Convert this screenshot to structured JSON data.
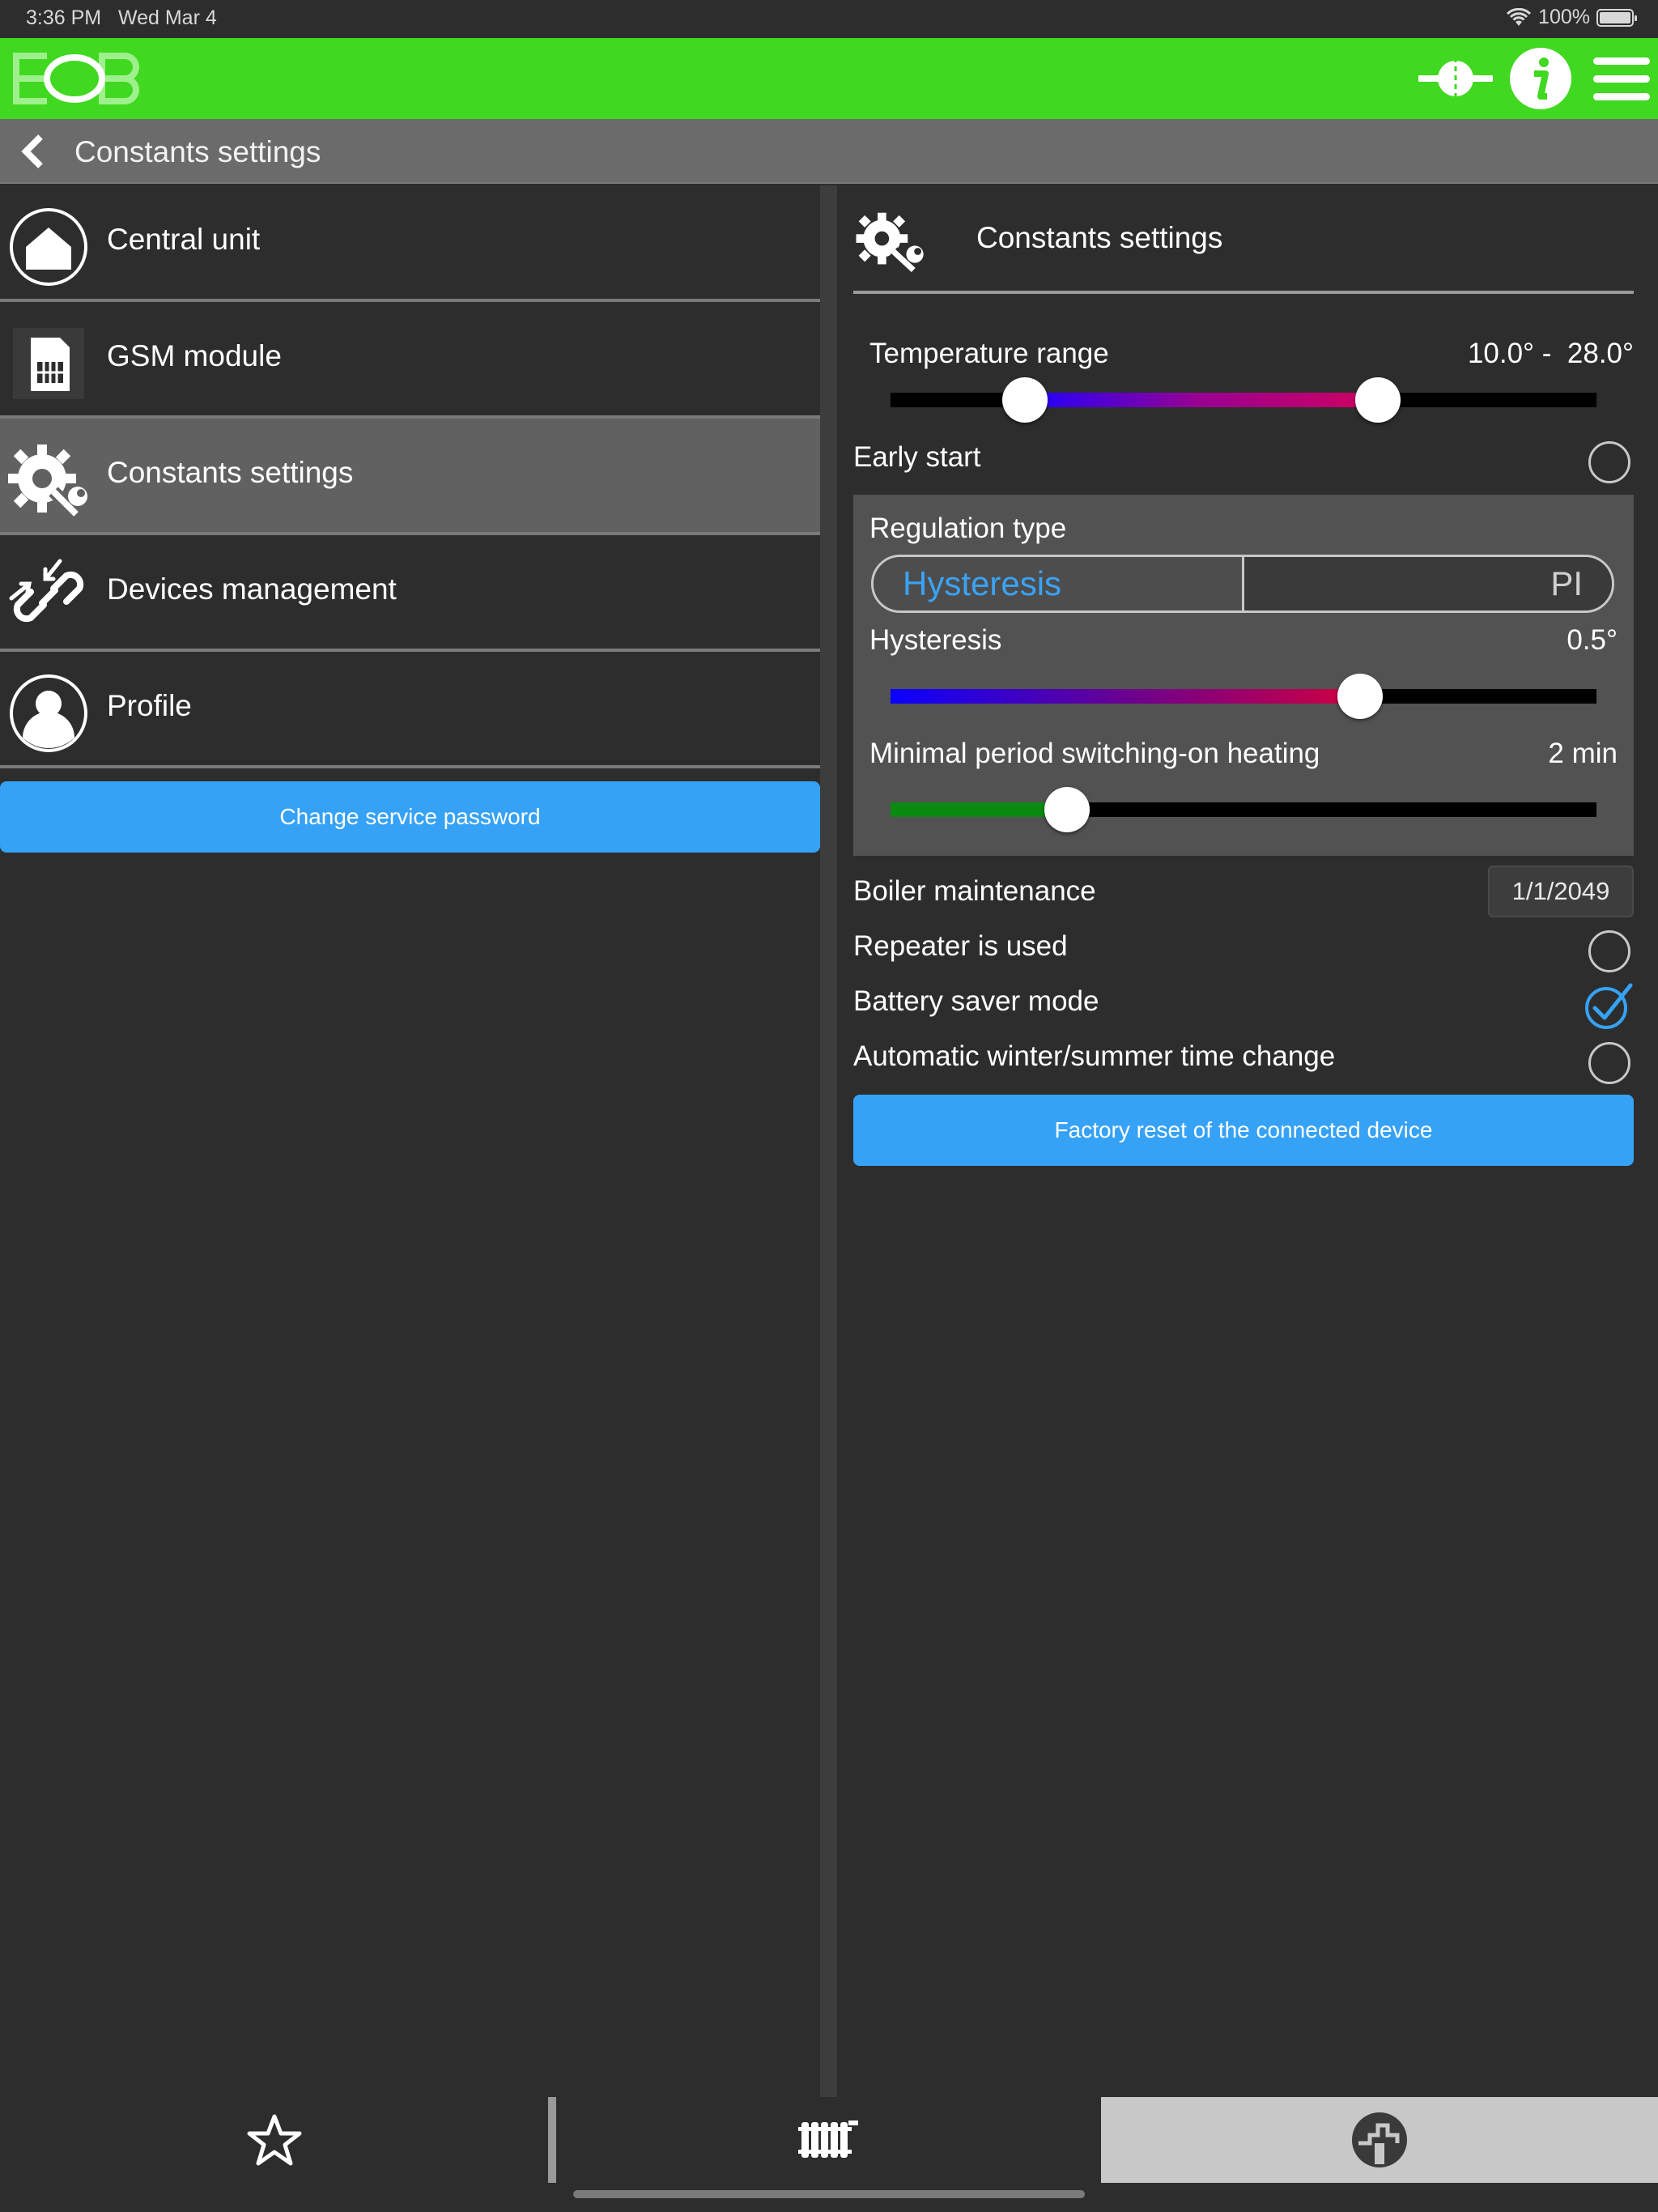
{
  "status_bar": {
    "time": "3:36 PM",
    "date": "Wed Mar 4",
    "battery": "100%"
  },
  "app_bar": {
    "logo_text": "EOB",
    "icons": [
      "target-icon",
      "info-icon",
      "hamburger-menu-icon"
    ],
    "color": "#40d820"
  },
  "title_bar": {
    "title": "Constants settings"
  },
  "menu": {
    "items": [
      {
        "label": "Central unit",
        "icon": "home-icon"
      },
      {
        "label": "GSM module",
        "icon": "sim-card-icon"
      },
      {
        "label": "Constants settings",
        "icon": "gear-wrench-icon",
        "active": true
      },
      {
        "label": "Devices management",
        "icon": "link-icon"
      },
      {
        "label": "Profile",
        "icon": "user-icon"
      }
    ],
    "change_password_label": "Change service password"
  },
  "settings": {
    "header_title": "Constants settings",
    "temperature_range": {
      "label": "Temperature range",
      "value_text": "10.0° -  28.0°",
      "low_fraction": 0.19,
      "high_fraction": 0.69
    },
    "early_start": {
      "label": "Early start",
      "checked": false
    },
    "regulation": {
      "label": "Regulation type",
      "options": [
        "Hysteresis",
        "PI"
      ],
      "selected": "Hysteresis",
      "hysteresis": {
        "label": "Hysteresis",
        "value_text": "0.5°",
        "fraction": 0.665
      },
      "min_period": {
        "label": "Minimal period switching-on heating",
        "value_text": "2 min",
        "fraction": 0.25
      }
    },
    "boiler_maintenance": {
      "label": "Boiler maintenance",
      "value": "1/1/2049"
    },
    "repeater": {
      "label": "Repeater is used",
      "checked": false
    },
    "battery_saver": {
      "label": "Battery saver mode",
      "checked": true
    },
    "dst_change": {
      "label": "Automatic winter/summer time change",
      "checked": false
    },
    "factory_reset_label": "Factory reset of the connected device"
  },
  "tab_bar": {
    "tabs": [
      "star-icon",
      "radiator-icon",
      "dashboard-icon"
    ],
    "active_index": 2
  },
  "colors": {
    "accent": "#36a2f6",
    "selected_bg": "#616161",
    "active_tab_bg": "#c8c8c8"
  }
}
